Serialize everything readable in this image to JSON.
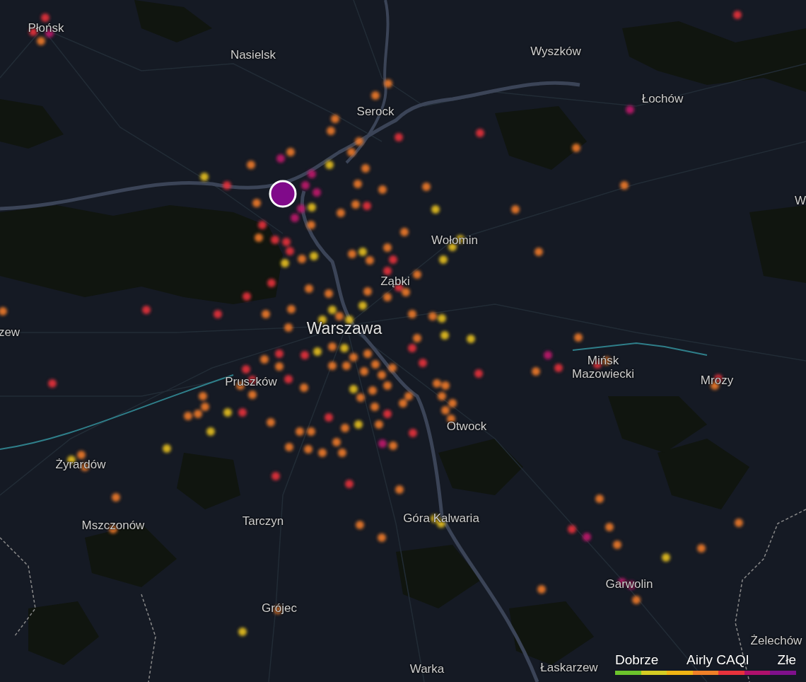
{
  "map": {
    "place_labels": [
      {
        "text": "Płońsk",
        "kind": "town"
      },
      {
        "text": "Nasielsk",
        "kind": "town"
      },
      {
        "text": "Wyszków",
        "kind": "town"
      },
      {
        "text": "Serock",
        "kind": "town"
      },
      {
        "text": "Łochów",
        "kind": "town"
      },
      {
        "text": "W",
        "kind": "town"
      },
      {
        "text": "Wołomin",
        "kind": "town"
      },
      {
        "text": "Ząbki",
        "kind": "town"
      },
      {
        "text": "Warszawa",
        "kind": "city"
      },
      {
        "text": "zew",
        "kind": "town"
      },
      {
        "text": "Mińsk Mazowiecki",
        "kind": "town"
      },
      {
        "text": "Pruszków",
        "kind": "town"
      },
      {
        "text": "Mrozy",
        "kind": "town"
      },
      {
        "text": "Otwock",
        "kind": "town"
      },
      {
        "text": "Żyrardów",
        "kind": "town"
      },
      {
        "text": "Mszczonów",
        "kind": "town"
      },
      {
        "text": "Tarczyn",
        "kind": "town"
      },
      {
        "text": "Góra Kalwaria",
        "kind": "town"
      },
      {
        "text": "Garwolin",
        "kind": "town"
      },
      {
        "text": "Grójec",
        "kind": "town"
      },
      {
        "text": "Warka",
        "kind": "town"
      },
      {
        "text": "Łaskarzew",
        "kind": "town"
      },
      {
        "text": "Żelechów",
        "kind": "town"
      }
    ]
  },
  "legend": {
    "low_label": "Dobrze",
    "title": "Airly CAQI",
    "high_label": "Złe",
    "scale": [
      {
        "color": "#6cc42c"
      },
      {
        "color": "#d4cc24"
      },
      {
        "color": "#f0b414"
      },
      {
        "color": "#f08028"
      },
      {
        "color": "#e8323c"
      },
      {
        "color": "#b0106c"
      },
      {
        "color": "#80108c"
      }
    ]
  }
}
